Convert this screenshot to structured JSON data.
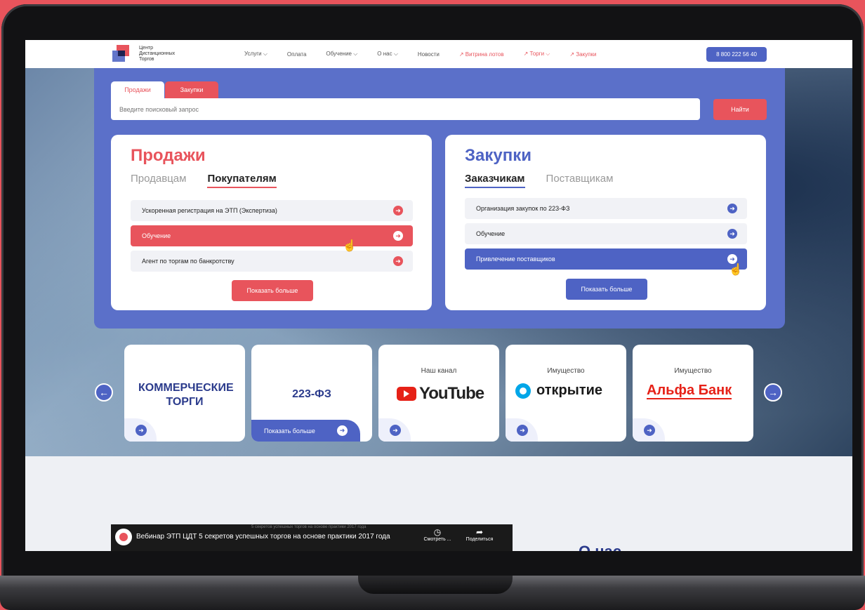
{
  "header": {
    "logo_lines": [
      "Центр",
      "Дистанционных",
      "Торгов"
    ],
    "nav": [
      {
        "label": "Услуги ⌵",
        "accent": false
      },
      {
        "label": "Оплата",
        "accent": false
      },
      {
        "label": "Обучение ⌵",
        "accent": false
      },
      {
        "label": "О нас ⌵",
        "accent": false
      },
      {
        "label": "Новости",
        "accent": false
      },
      {
        "label": "↗ Витрина лотов",
        "accent": true
      },
      {
        "label": "↗ Торги ⌵",
        "accent": true
      },
      {
        "label": "↗ Закупки",
        "accent": true
      }
    ],
    "phone": "8 800 222 56 40"
  },
  "search": {
    "tab_sales": "Продажи",
    "tab_purchases": "Закупки",
    "placeholder": "Введите поисковый запрос",
    "button": "Найти"
  },
  "sales": {
    "title": "Продажи",
    "tab_sellers": "Продавцам",
    "tab_buyers": "Покупателям",
    "items": [
      "Ускоренная регистрация на ЭТП (Экспертиза)",
      "Обучение",
      "Агент по торгам по банкротству"
    ],
    "more": "Показать больше"
  },
  "purchases": {
    "title": "Закупки",
    "tab_customers": "Заказчикам",
    "tab_suppliers": "Поставщикам",
    "items": [
      "Организация закупок по 223-ФЗ",
      "Обучение",
      "Привлечение поставщиков"
    ],
    "more": "Показать больше"
  },
  "carousel": {
    "tiles": [
      {
        "caption": "",
        "main": "КОММЕРЧЕСКИЕ ТОРГИ"
      },
      {
        "caption": "",
        "main": "223-ФЗ",
        "more": "Показать больше"
      },
      {
        "caption": "Наш канал",
        "main": "YouTube"
      },
      {
        "caption": "Имущество",
        "main": "открытие"
      },
      {
        "caption": "Имущество",
        "main": "Альфа Банк"
      }
    ]
  },
  "video": {
    "title": "Вебинар ЭТП ЦДТ 5 секретов успешных торгов на основе практики 2017 года",
    "subtitle": "5 секретов успешных торгов на основе практики 2017 года",
    "watch": "Смотреть ...",
    "share": "Поделиться"
  },
  "about_title": "О нас",
  "colors": {
    "accent_red": "#e8545c",
    "accent_blue": "#4e63c4",
    "panel_blue": "#5b70c9"
  }
}
